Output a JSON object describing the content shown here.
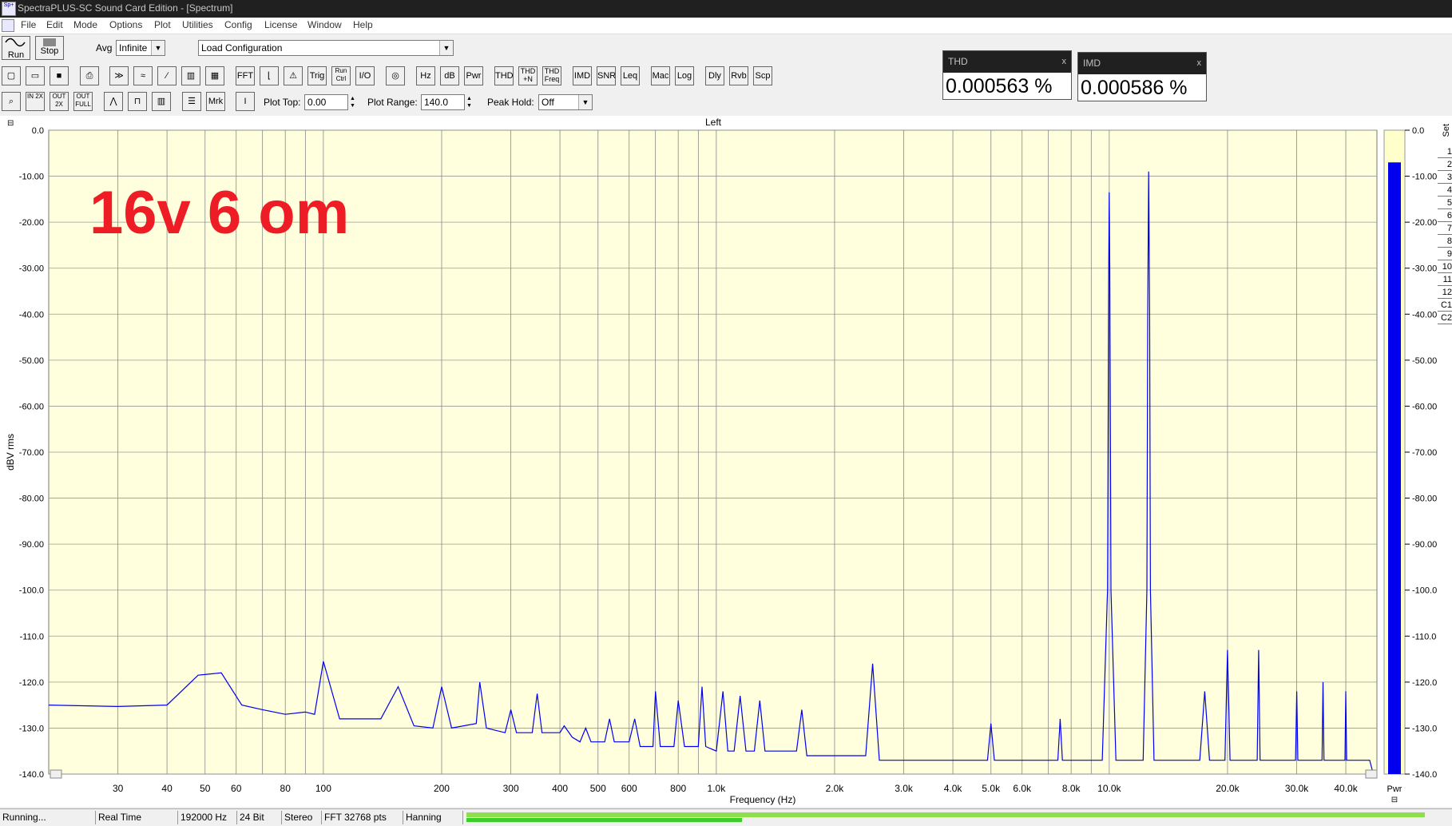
{
  "window": {
    "title": "SpectraPLUS-SC Sound Card Edition - [Spectrum]",
    "app_icon_text": "Sp+"
  },
  "menu": [
    "File",
    "Edit",
    "Mode",
    "Options",
    "Plot",
    "Utilities",
    "Config",
    "License",
    "Window",
    "Help"
  ],
  "controls": {
    "run_label": "Run",
    "stop_label": "Stop",
    "avg_label": "Avg",
    "avg_value": "Infinite",
    "config_value": "Load Configuration",
    "plot_top_label": "Plot Top:",
    "plot_top_value": "0.00",
    "plot_range_label": "Plot Range:",
    "plot_range_value": "140.0",
    "peak_hold_label": "Peak Hold:",
    "peak_hold_value": "Off"
  },
  "toolbar1": [
    "",
    "",
    "",
    "",
    "",
    "",
    "",
    "",
    "",
    "",
    "FFT",
    "",
    "",
    "Trig",
    "Run Ctrl",
    "I/O",
    "",
    "Hz",
    "dB",
    "Pwr",
    "THD",
    "THD +N",
    "THD Freq",
    "IMD",
    "SNR",
    "Leq",
    "Mac",
    "Log",
    "Dly",
    "Rvb",
    "Scp"
  ],
  "toolbar2": [
    "",
    "IN 2X",
    "OUT 2X",
    "OUT FULL",
    "",
    "",
    "",
    "",
    "Mrk",
    ""
  ],
  "meters": [
    {
      "name": "THD",
      "value": "0.000563 %",
      "close": "x"
    },
    {
      "name": "IMD",
      "value": "0.000586 %",
      "close": "x"
    }
  ],
  "plot": {
    "channel_title": "Left",
    "annotation": "16v 6 om",
    "pwr_label": "Pwr",
    "set_label": "Set",
    "set_items": [
      "1",
      "2",
      "3",
      "4",
      "5",
      "6",
      "7",
      "8",
      "9",
      "10",
      "11",
      "12",
      "C1",
      "C2"
    ],
    "right_ticks": [
      "0.0",
      "-10.00",
      "-20.00",
      "-30.00",
      "-40.00",
      "-50.00",
      "-60.00",
      "-70.00",
      "-80.00",
      "-90.00",
      "-100.0",
      "-110.0",
      "-120.0",
      "-130.0",
      "-140.0"
    ],
    "power_level_db": -7
  },
  "chart_data": {
    "type": "line",
    "title": "Left",
    "xlabel": "Frequency (Hz)",
    "ylabel": "dBV rms",
    "xscale": "log",
    "xlim": [
      20,
      48000
    ],
    "ylim": [
      -140,
      0
    ],
    "grid": true,
    "x_ticks": [
      {
        "v": 30,
        "label": "30"
      },
      {
        "v": 40,
        "label": "40"
      },
      {
        "v": 50,
        "label": "50"
      },
      {
        "v": 60,
        "label": "60"
      },
      {
        "v": 80,
        "label": "80"
      },
      {
        "v": 100,
        "label": "100"
      },
      {
        "v": 200,
        "label": "200"
      },
      {
        "v": 300,
        "label": "300"
      },
      {
        "v": 400,
        "label": "400"
      },
      {
        "v": 500,
        "label": "500"
      },
      {
        "v": 600,
        "label": "600"
      },
      {
        "v": 800,
        "label": "800"
      },
      {
        "v": 1000,
        "label": "1.0k"
      },
      {
        "v": 2000,
        "label": "2.0k"
      },
      {
        "v": 3000,
        "label": "3.0k"
      },
      {
        "v": 4000,
        "label": "4.0k"
      },
      {
        "v": 5000,
        "label": "5.0k"
      },
      {
        "v": 6000,
        "label": "6.0k"
      },
      {
        "v": 8000,
        "label": "8.0k"
      },
      {
        "v": 10000,
        "label": "10.0k"
      },
      {
        "v": 20000,
        "label": "20.0k"
      },
      {
        "v": 30000,
        "label": "30.0k"
      },
      {
        "v": 40000,
        "label": "40.0k"
      }
    ],
    "y_ticks": [
      "0.0",
      "-10.00",
      "-20.00",
      "-30.00",
      "-40.00",
      "-50.00",
      "-60.00",
      "-70.00",
      "-80.00",
      "-90.00",
      "-100.0",
      "-110.0",
      "-120.0",
      "-130.0",
      "-140.0"
    ],
    "series": [
      {
        "color": "#0000ff",
        "points": [
          [
            20,
            -125
          ],
          [
            30,
            -125.3
          ],
          [
            40,
            -125
          ],
          [
            48,
            -118.5
          ],
          [
            55,
            -118
          ],
          [
            62,
            -125
          ],
          [
            70,
            -126
          ],
          [
            80,
            -127
          ],
          [
            90,
            -126.5
          ],
          [
            95,
            -127
          ],
          [
            100,
            -115.5
          ],
          [
            110,
            -128
          ],
          [
            140,
            -128
          ],
          [
            155,
            -121
          ],
          [
            170,
            -129.5
          ],
          [
            190,
            -130
          ],
          [
            200,
            -121
          ],
          [
            212,
            -130
          ],
          [
            245,
            -129
          ],
          [
            250,
            -120
          ],
          [
            260,
            -130
          ],
          [
            290,
            -131
          ],
          [
            300,
            -126
          ],
          [
            310,
            -131
          ],
          [
            340,
            -131
          ],
          [
            350,
            -122.5
          ],
          [
            360,
            -131
          ],
          [
            400,
            -131
          ],
          [
            410,
            -129.5
          ],
          [
            430,
            -132
          ],
          [
            450,
            -133
          ],
          [
            465,
            -130
          ],
          [
            480,
            -133
          ],
          [
            520,
            -133
          ],
          [
            535,
            -128
          ],
          [
            550,
            -133
          ],
          [
            600,
            -133
          ],
          [
            620,
            -128
          ],
          [
            640,
            -134
          ],
          [
            690,
            -134
          ],
          [
            700,
            -122
          ],
          [
            720,
            -134
          ],
          [
            780,
            -134
          ],
          [
            800,
            -124
          ],
          [
            830,
            -134
          ],
          [
            900,
            -134
          ],
          [
            920,
            -121
          ],
          [
            940,
            -134
          ],
          [
            1000,
            -135
          ],
          [
            1040,
            -122
          ],
          [
            1070,
            -135
          ],
          [
            1110,
            -135
          ],
          [
            1150,
            -123
          ],
          [
            1190,
            -135
          ],
          [
            1250,
            -135
          ],
          [
            1290,
            -124
          ],
          [
            1330,
            -135
          ],
          [
            1600,
            -135
          ],
          [
            1650,
            -126
          ],
          [
            1700,
            -136
          ],
          [
            2400,
            -136
          ],
          [
            2500,
            -116
          ],
          [
            2600,
            -137
          ],
          [
            4900,
            -137
          ],
          [
            5000,
            -129
          ],
          [
            5100,
            -137
          ],
          [
            7400,
            -137
          ],
          [
            7500,
            -128
          ],
          [
            7600,
            -137
          ],
          [
            9600,
            -137
          ],
          [
            9900,
            -100
          ],
          [
            9970,
            -30
          ],
          [
            10000,
            -13.5
          ],
          [
            10030,
            -30
          ],
          [
            10100,
            -100
          ],
          [
            10400,
            -137
          ],
          [
            12200,
            -137
          ],
          [
            12470,
            -100
          ],
          [
            12530,
            -40
          ],
          [
            12600,
            -9
          ],
          [
            12670,
            -40
          ],
          [
            12730,
            -100
          ],
          [
            13000,
            -137
          ],
          [
            17000,
            -137
          ],
          [
            17500,
            -122
          ],
          [
            18000,
            -137
          ],
          [
            19700,
            -137
          ],
          [
            20000,
            -113
          ],
          [
            20300,
            -137
          ],
          [
            23800,
            -137
          ],
          [
            24000,
            -113
          ],
          [
            24200,
            -137
          ],
          [
            29800,
            -137
          ],
          [
            30000,
            -122
          ],
          [
            30200,
            -137
          ],
          [
            34800,
            -137
          ],
          [
            35000,
            -120
          ],
          [
            35200,
            -137
          ],
          [
            39800,
            -137
          ],
          [
            40000,
            -122
          ],
          [
            40200,
            -137
          ],
          [
            46000,
            -137
          ],
          [
            47000,
            -140
          ]
        ]
      }
    ]
  },
  "statusbar": [
    "Running...",
    "Real Time",
    "192000 Hz",
    "24 Bit",
    "Stereo",
    "FFT 32768 pts",
    "Hanning"
  ]
}
